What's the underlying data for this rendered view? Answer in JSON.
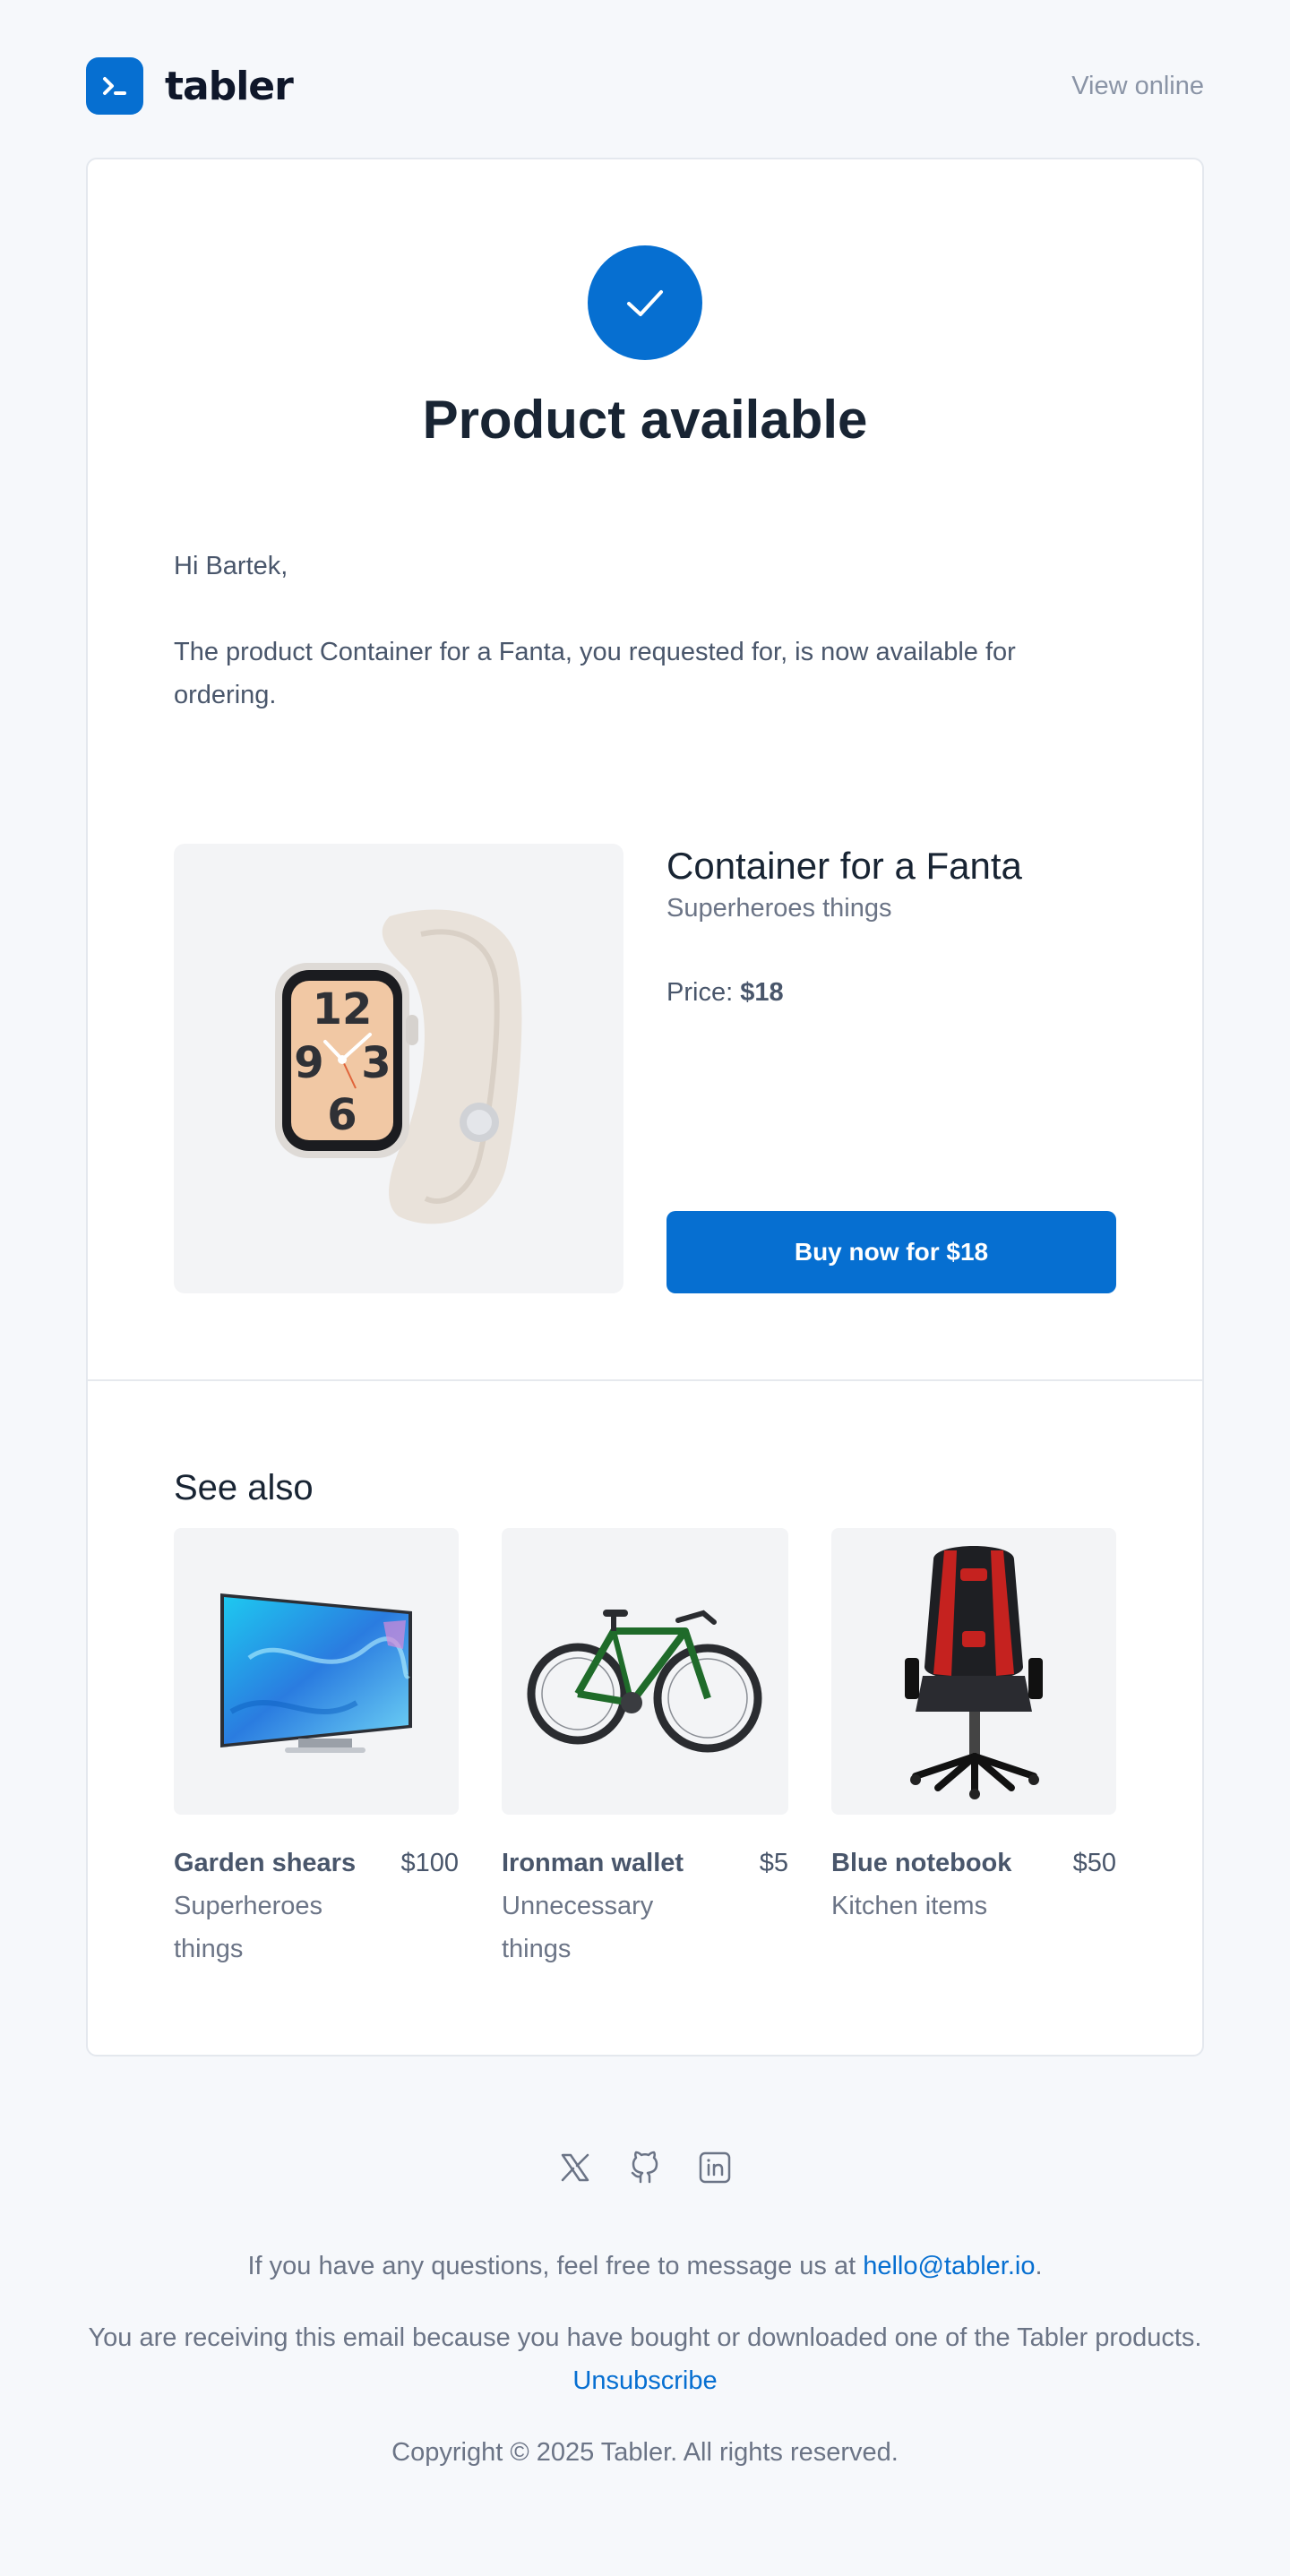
{
  "brand": {
    "name": "tabler",
    "color": "#066fd1"
  },
  "header": {
    "view_online": "View online"
  },
  "hero": {
    "icon": "check-icon",
    "title": "Product available"
  },
  "body": {
    "greeting": "Hi Bartek,",
    "message": "The product Container for a Fanta, you requested for, is now available for ordering."
  },
  "product": {
    "image": "smartwatch-image",
    "name": "Container for a Fanta",
    "category": "Superheroes things",
    "price_label": "Price:",
    "price": "$18",
    "buy_button": "Buy now for $18"
  },
  "see_also": {
    "title": "See also",
    "items": [
      {
        "image": "tv-image",
        "name": "Garden shears",
        "price": "$100",
        "category": "Superheroes things"
      },
      {
        "image": "bicycle-image",
        "name": "Ironman wallet",
        "price": "$5",
        "category": "Unnecessary things"
      },
      {
        "image": "gaming-chair-image",
        "name": "Blue notebook",
        "price": "$50",
        "category": "Kitchen items"
      }
    ]
  },
  "footer": {
    "socials": [
      "x-icon",
      "github-icon",
      "linkedin-icon"
    ],
    "questions_text": "If you have any questions, feel free to message us at",
    "email": "hello@tabler.io",
    "questions_end": ".",
    "receiving_text": "You are receiving this email because you have bought or downloaded one of the Tabler products.",
    "unsubscribe": "Unsubscribe",
    "copyright": "Copyright © 2025 Tabler. All rights reserved."
  }
}
